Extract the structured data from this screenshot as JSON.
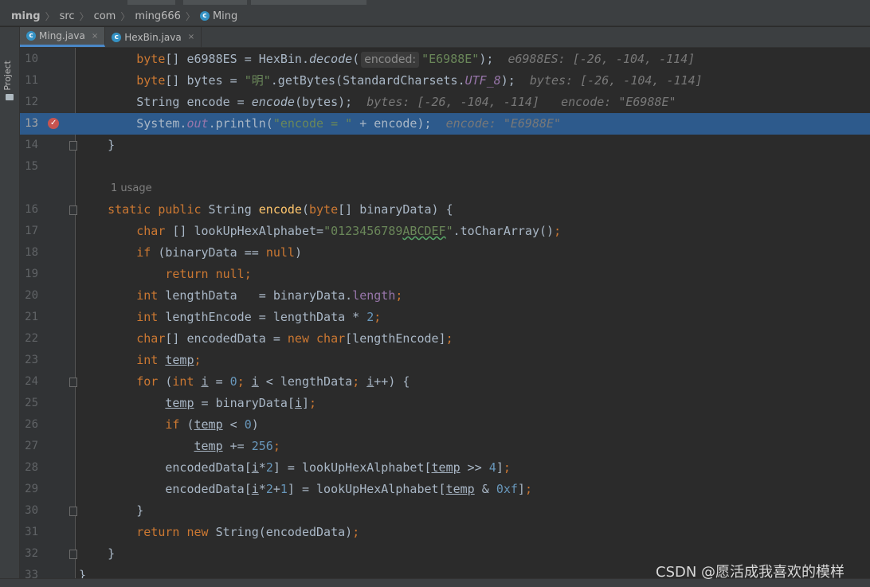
{
  "breadcrumb": [
    "ming",
    "src",
    "com",
    "ming666",
    "Ming"
  ],
  "sidebar": {
    "project_label": "Project"
  },
  "tabs": [
    {
      "label": "Ming.java",
      "close": "×",
      "active": true
    },
    {
      "label": "HexBin.java",
      "close": "×",
      "active": false
    }
  ],
  "editor": {
    "line_numbers": [
      "10",
      "11",
      "12",
      "13",
      "14",
      "15",
      "16",
      "17",
      "18",
      "19",
      "20",
      "21",
      "22",
      "23",
      "24",
      "25",
      "26",
      "27",
      "28",
      "29",
      "30",
      "31",
      "32",
      "33"
    ],
    "usage_hint": "1 usage",
    "param_hint": "encoded:",
    "debug_hints": {
      "line10": "e6988ES: [-26, -104, -114]",
      "line11": "bytes: [-26, -104, -114]",
      "line12": "bytes: [-26, -104, -114]   encode: \"E6988E\"",
      "line13": "encode: \"E6988E\""
    }
  },
  "watermark": "CSDN @愿活成我喜欢的模样",
  "colors": {
    "highlight": "#2d5a8c",
    "keyword": "#cc7832",
    "string": "#6a8759",
    "number": "#6897bb",
    "breakpoint": "#c75450"
  }
}
